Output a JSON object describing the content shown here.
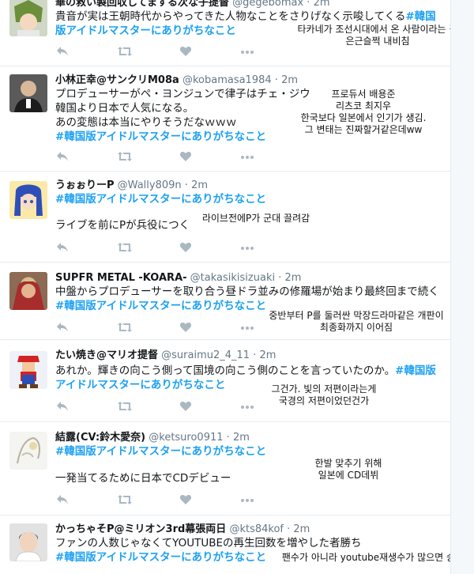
{
  "colors": {
    "hashtag": "#1da1f2",
    "handle": "#657786",
    "icon": "#aab8c2",
    "border": "#e6ecf0"
  },
  "tweets": [
    {
      "name": "華の救い製回収してまする次な子提督",
      "handle": "@gegebomax",
      "time": "2m",
      "line1": "貴音が実は王朝時代からやってきた人物なことをさりげなく示唆してくる",
      "hashtag_inline": "#韓国",
      "hashtag_line2": "版アイドルマスターにありがちなこと",
      "avatar_icon": "anime-avatar-icon",
      "overlay": [
        "타카네가 조선시대에서 온 사람이라는 걸",
        "은근슬쩍 내비침"
      ]
    },
    {
      "name": "小林正幸@サンクリM08a",
      "handle": "@kobamasa1984",
      "time": "2m",
      "line1": "プロデューサーがペ・ヨンジュンで律子はチェ・ジウ",
      "line2": "韓国より日本で人気になる。",
      "line3": "あの変態は本当にやりそうだなｗｗｗ",
      "hashtag": "#韓国版アイドルマスターにありがちなこと",
      "avatar_icon": "person-avatar-icon",
      "overlay": [
        "프로듀서 배용준",
        "리츠코 최지우",
        "한국보다 일본에서 인기가 생김.",
        "그 변태는 진짜할거같은데ww"
      ]
    },
    {
      "name": "うぉぉりーP",
      "handle": "@Wally809n",
      "time": "2m",
      "hashtag": "#韓国版アイドルマスターにありがちなこと",
      "line1": "ライブを前にPが兵役につく",
      "avatar_icon": "anime-avatar-icon",
      "overlay": [
        "라이브전에P가 군대 끌려감"
      ]
    },
    {
      "name": "SUPFR METAL -KOARA-",
      "handle": "@takasikisizuaki",
      "time": "2m",
      "line1": "中盤からプロデューサーを取り合う昼ドラ並みの修羅場が始まり最終回まで続く",
      "hashtag": "#韓国版アイドルマスターにありがちなこと",
      "avatar_icon": "anime-avatar-icon",
      "overlay": [
        "중반부터 P를 둘러싼 막장드라마같은 개판이",
        "최종화까지 이어짐"
      ]
    },
    {
      "name": "たい焼き@マリオ提督",
      "handle": "@suraimu2_4_11",
      "time": "2m",
      "line1": "あれか。輝きの向こう側って国境の向こう側のことを言っていたのか。",
      "hashtag_inline": "#韓国版",
      "hashtag_line2": "アイドルマスターにありがちなこと",
      "avatar_icon": "mario-avatar-icon",
      "overlay": [
        "그건가. 빛의 저편이라는게",
        "국경의 저편이었던건가"
      ]
    },
    {
      "name": "結露(CV:鈴木愛奈)",
      "handle": "@ketsuro0911",
      "time": "2m",
      "hashtag": "#韓国版アイドルマスターにありがちなこと",
      "line1": "一発当てるために日本でCDデビュー",
      "avatar_icon": "sketch-avatar-icon",
      "overlay": [
        "한발 맞추기 위해",
        "일본에 CD데뷔"
      ]
    },
    {
      "name": "かっちゃそP@ミリオン3rd幕張両日",
      "handle": "@kts84kof",
      "time": "2m",
      "line1": "ファンの人数じゃなくてYOUTUBEの再生回数を増やした者勝ち",
      "hashtag": "#韓国版アイドルマスターにありがちなこと",
      "avatar_icon": "person-avatar-icon",
      "overlay": [
        "팬수가 아니라 youtube재생수가 많으면 승리"
      ]
    }
  ],
  "action_icons": [
    "reply-icon",
    "retweet-icon",
    "like-icon",
    "more-icon"
  ]
}
